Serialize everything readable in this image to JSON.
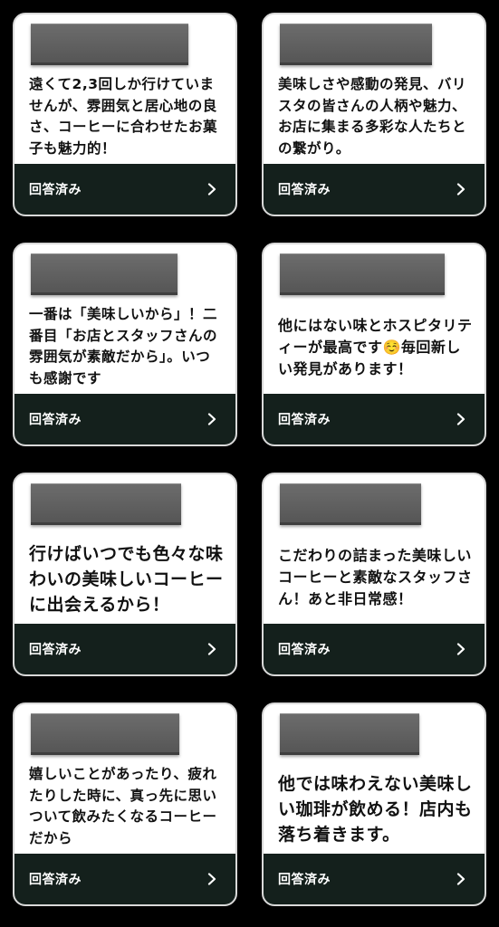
{
  "reviews": [
    {
      "text": "遠くて2,3回しか行けていませんが、雰囲気と居心地の良さ、コーヒーに合わせたお菓子も魅力的！",
      "status_label": "回答済み",
      "chevron_icon": "chevron-right-icon"
    },
    {
      "text": "美味しさや感動の発見、バリスタの皆さんの人柄や魅力、お店に集まる多彩な人たちとの繋がり。",
      "status_label": "回答済み",
      "chevron_icon": "chevron-right-icon"
    },
    {
      "text": "一番は「美味しいから」！二番目「お店とスタッフさんの雰囲気が素敵だから」。いつも感謝です",
      "status_label": "回答済み",
      "chevron_icon": "chevron-right-icon"
    },
    {
      "text": "他にはない味とホスピタリティーが最高です☺️毎回新しい発見があります！",
      "status_label": "回答済み",
      "chevron_icon": "chevron-right-icon"
    },
    {
      "text": "行けばいつでも色々な味わいの美味しいコーヒーに出会えるから！",
      "status_label": "回答済み",
      "chevron_icon": "chevron-right-icon"
    },
    {
      "text": "こだわりの詰まった美味しいコーヒーと素敵なスタッフさん！あと非日常感！",
      "status_label": "回答済み",
      "chevron_icon": "chevron-right-icon"
    },
    {
      "text": "嬉しいことがあったり、疲れたりした時に、真っ先に思いついて飲みたくなるコーヒーだから",
      "status_label": "回答済み",
      "chevron_icon": "chevron-right-icon"
    },
    {
      "text": "他では味わえない美味しい珈琲が飲める！店内も落ち着きます。",
      "status_label": "回答済み",
      "chevron_icon": "chevron-right-icon"
    }
  ],
  "colors": {
    "page_background": "#000000",
    "card_background": "#ffffff",
    "footer_background": "#14201c",
    "redaction_block": "#636363",
    "body_text": "#111111",
    "footer_text": "#ffffff"
  }
}
